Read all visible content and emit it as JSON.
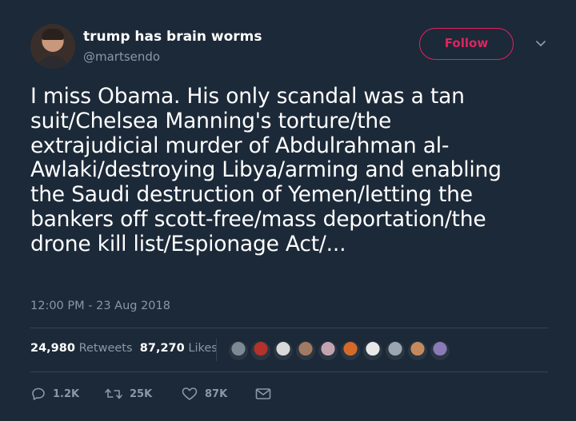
{
  "author": {
    "display_name": "trump has brain worms",
    "handle": "@martsendo"
  },
  "follow_label": "Follow",
  "tweet_text": "I miss Obama. His only scandal was a tan\nsuit/Chelsea Manning's torture/the\nextrajudicial murder of Abdulrahman al-\nAwlaki/destroying Libya/arming and enabling\nthe Saudi destruction of Yemen/letting the\nbankers off scott-free/mass deportation/the\ndrone kill list/Espionage Act/...",
  "timestamp": "12:00 PM - 23 Aug 2018",
  "stats": {
    "retweets_count": "24,980",
    "retweets_label": "Retweets",
    "likes_count": "87,270",
    "likes_label": "Likes"
  },
  "likers_avatar_colors": [
    "#7d8a96",
    "#b5312b",
    "#d9d9d9",
    "#a17a63",
    "#c4a3b0",
    "#d46a2a",
    "#e8e8e8",
    "#9aa6b2",
    "#c48a5e",
    "#8a7ab5"
  ],
  "actions": {
    "reply_count": "1.2K",
    "retweet_count": "25K",
    "like_count": "87K"
  },
  "colors": {
    "background": "#1c2938",
    "accent": "#e0245e",
    "secondary_text": "#8899a6",
    "divider": "#38444d"
  },
  "icons": [
    "reply-icon",
    "retweet-icon",
    "heart-icon",
    "message-icon",
    "chevron-down-icon"
  ]
}
